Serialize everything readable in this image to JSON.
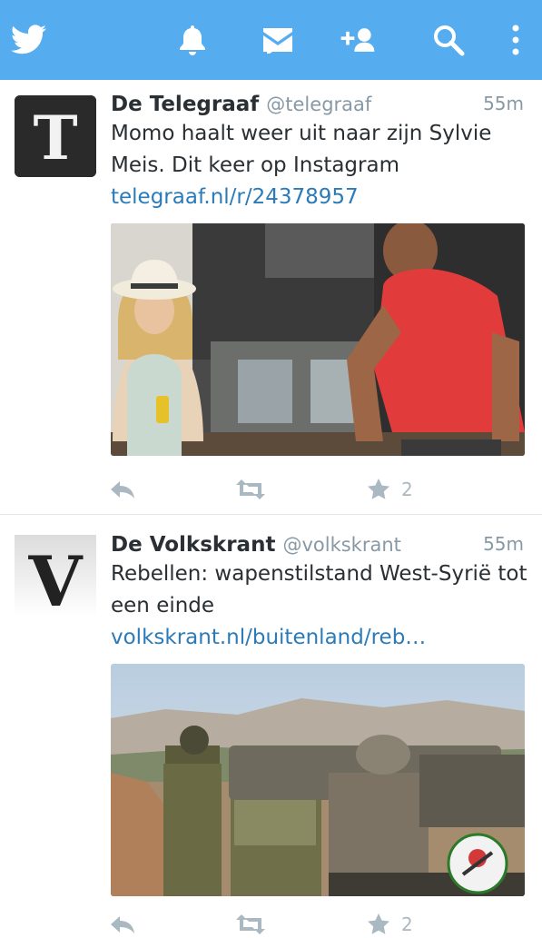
{
  "topbar": {
    "background": "#55acee",
    "icons": [
      "twitter-bird-icon",
      "bell-icon",
      "envelope-icon",
      "add-user-icon",
      "search-icon",
      "more-vertical-icon"
    ]
  },
  "tweets": [
    {
      "author": "De Telegraaf",
      "handle": "@telegraaf",
      "time": "55m",
      "text": "Momo haalt weer uit naar zijn Sylvie Meis. Dit keer op Instagram",
      "link": "telegraaf.nl/r/24378957",
      "favorites": "2",
      "avatar_letter": "T"
    },
    {
      "author": "De Volkskrant",
      "handle": "@volkskrant",
      "time": "55m",
      "text": "Rebellen: wapenstilstand West-Syrië tot een einde ",
      "link": "volkskrant.nl/buitenland/reb…",
      "favorites": "2",
      "avatar_letter": "V"
    }
  ]
}
